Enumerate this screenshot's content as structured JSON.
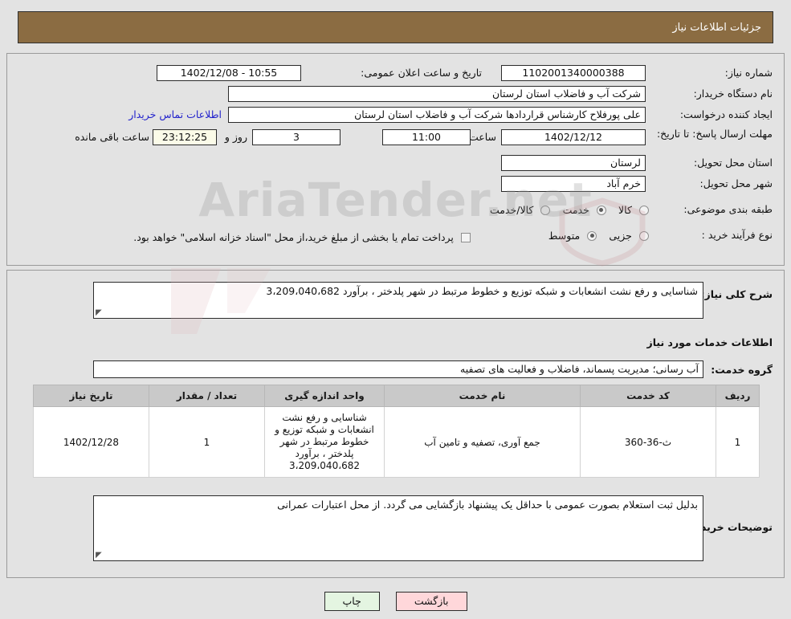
{
  "header": {
    "title": "جزئیات اطلاعات نیاز"
  },
  "watermark": {
    "text": "AriaTender.net"
  },
  "form": {
    "need_number": {
      "label": "شماره نیاز:",
      "value": "1102001340000388"
    },
    "announce_datetime": {
      "label": "تاریخ و ساعت اعلان عمومی:",
      "value": "1402/12/08 - 10:55"
    },
    "buyer_org": {
      "label": "نام دستگاه خریدار:",
      "value": "شرکت آب و فاضلاب استان لرستان"
    },
    "requester": {
      "label": "ایجاد کننده درخواست:",
      "value": "علی پورفلاح کارشناس قراردادها شرکت آب و فاضلاب استان لرستان"
    },
    "contact_link": {
      "label": "اطلاعات تماس خریدار"
    },
    "deadline": {
      "label": "مهلت ارسال پاسخ: تا تاریخ:",
      "date": "1402/12/12",
      "time_label": "ساعت",
      "time": "11:00",
      "days": "3",
      "days_label": "روز و",
      "countdown": "23:12:25",
      "countdown_label": "ساعت باقی مانده"
    },
    "delivery_province": {
      "label": "استان محل تحویل:",
      "value": "لرستان"
    },
    "delivery_city": {
      "label": "شهر محل تحویل:",
      "value": "خرم آباد"
    },
    "category": {
      "label": "طبقه بندی موضوعی:",
      "options": [
        {
          "label": "کالا",
          "selected": false
        },
        {
          "label": "خدمت",
          "selected": true
        },
        {
          "label": "کالا/خدمت",
          "selected": false
        }
      ]
    },
    "purchase_type": {
      "label": "نوع فرآیند خرید :",
      "options": [
        {
          "label": "جزیی",
          "selected": false
        },
        {
          "label": "متوسط",
          "selected": true
        }
      ],
      "checkbox_note": "پرداخت تمام یا بخشی از مبلغ خرید،از محل \"اسناد خزانه اسلامی\" خواهد بود.",
      "checkbox_checked": false
    }
  },
  "description": {
    "label": "شرح کلی نیاز:",
    "value": "شناسایی و رفع نشت انشعابات و شبکه توزیع و خطوط مرتبط در شهر پلدختر ، برآورد 3،209،040،682"
  },
  "services_section": {
    "title": "اطلاعات خدمات مورد نیاز",
    "group_label": "گروه خدمت:",
    "group_value": "آب رسانی؛ مدیریت پسماند، فاضلاب و فعالیت های تصفیه"
  },
  "table": {
    "headers": [
      "ردیف",
      "کد خدمت",
      "نام خدمت",
      "واحد اندازه گیری",
      "تعداد / مقدار",
      "تاریخ نیاز"
    ],
    "rows": [
      {
        "row": "1",
        "code": "ث-36-360",
        "name": "جمع آوری، تصفیه و تامین آب",
        "unit": "شناسایی و رفع نشت انشعابات و شبکه توزیع و خطوط مرتبط در شهر پلدختر ، برآورد 3،209،040،682",
        "qty": "1",
        "date": "1402/12/28"
      }
    ]
  },
  "buyer_notes": {
    "label": "توضیحات خریدار:",
    "value": "بدلیل ثبت استعلام بصورت عمومی با حداقل یک پیشنهاد بازگشایی می گردد. از محل اعتبارات عمرانی"
  },
  "buttons": {
    "back": "بازگشت",
    "print": "چاپ"
  }
}
